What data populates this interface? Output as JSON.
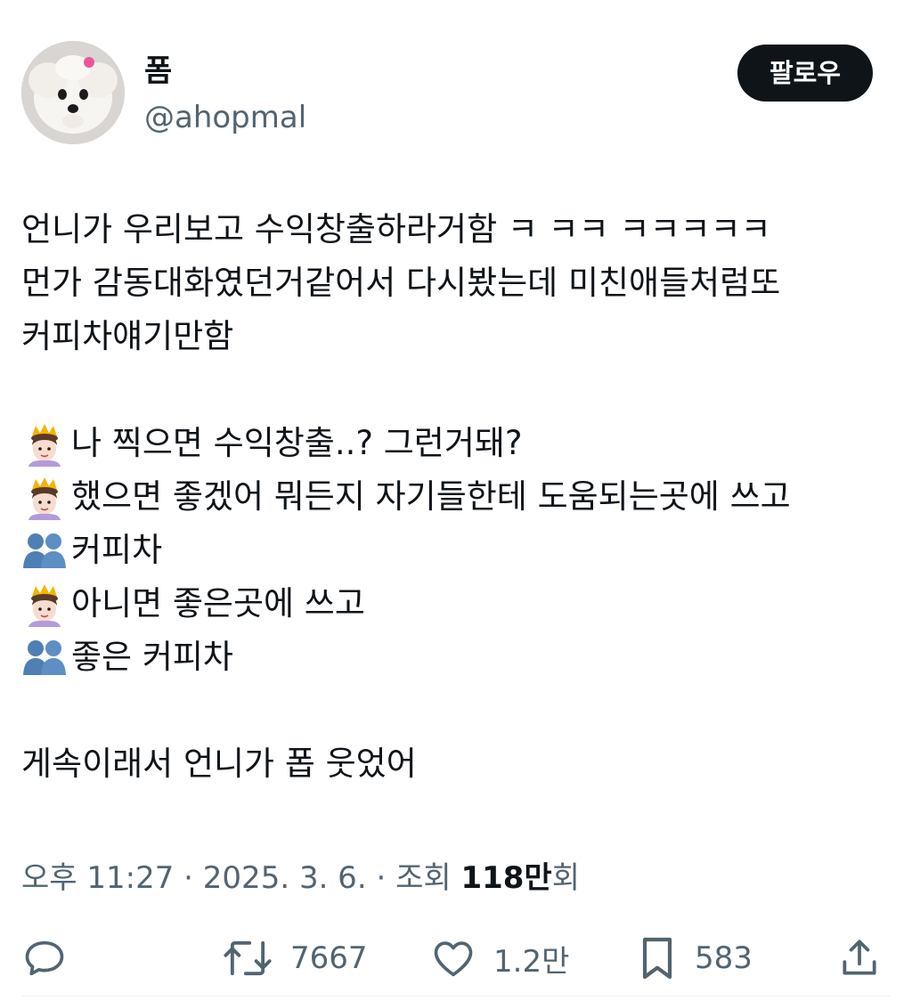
{
  "user": {
    "display_name": "폼",
    "handle": "@ahopmal",
    "follow_label": "팔로우"
  },
  "tweet": {
    "lines": [
      {
        "text": "언니가 우리보고 수익창출하라거함 ㅋ ㅋㅋ ㅋㅋㅋㅋㅋ",
        "emoji": ""
      },
      {
        "text": "먼가 감동대화였던거같어서 다시봤는데 미친애들처럼또",
        "emoji": ""
      },
      {
        "text": "커피차얘기만함",
        "emoji": ""
      },
      {
        "text": "",
        "emoji": ""
      },
      {
        "text": "나 찍으면 수익창출..? 그런거돼?",
        "emoji": "princess-icon"
      },
      {
        "text": "했으면 좋겠어 뭐든지 자기들한테 도움되는곳에 쓰고",
        "emoji": "princess-icon"
      },
      {
        "text": "커피차",
        "emoji": "two-people-icon"
      },
      {
        "text": "아니면 좋은곳에 쓰고",
        "emoji": "princess-icon"
      },
      {
        "text": "좋은 커피차",
        "emoji": "two-people-icon"
      },
      {
        "text": "",
        "emoji": ""
      },
      {
        "text": "게속이래서 언니가 폽 웃었어",
        "emoji": ""
      }
    ]
  },
  "meta": {
    "time": "오후 11:27",
    "sep1": " · ",
    "date": "2025. 3. 6.",
    "sep2": " · ",
    "views_label": "조회 ",
    "views_count": "118만",
    "views_suffix": "회"
  },
  "actions": {
    "reply_count": "",
    "retweet_count": "7667",
    "like_count": "1.2만",
    "bookmark_count": "583"
  },
  "icons": {
    "reply": "comment-bubble-icon",
    "retweet": "retweet-icon",
    "like": "heart-icon",
    "bookmark": "bookmark-icon",
    "share": "share-icon"
  },
  "colors": {
    "text": "#0f1419",
    "secondary": "#536471",
    "button_bg": "#0f1419",
    "button_text": "#ffffff"
  }
}
